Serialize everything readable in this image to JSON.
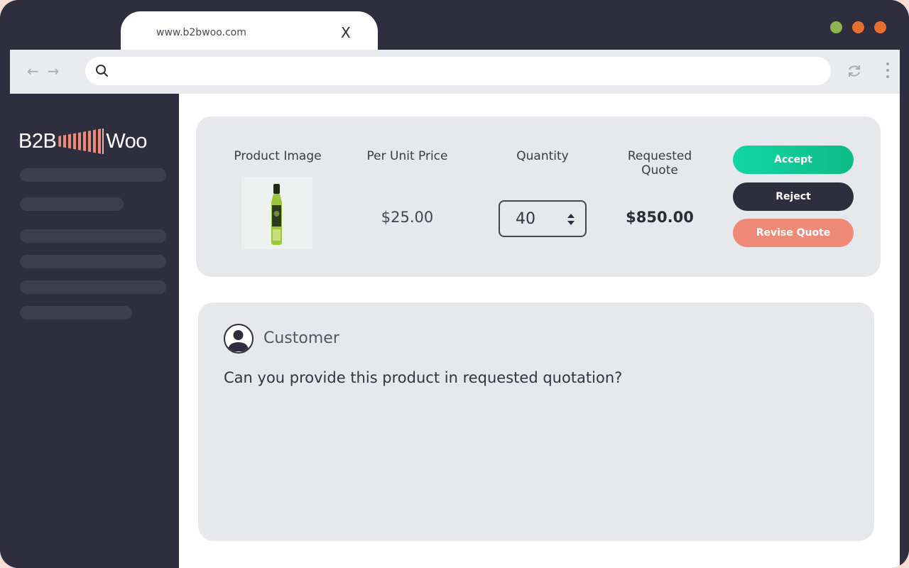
{
  "browser": {
    "tab_title": "www.b2bwoo.com",
    "tab_close": "X",
    "back": "←",
    "forward": "→",
    "url_value": "",
    "dot_colors": [
      "#8fb44f",
      "#e8702f",
      "#e8702f"
    ]
  },
  "sidebar": {
    "logo_left": "B2B",
    "logo_right": "Woo",
    "placeholder_count": 6
  },
  "quote": {
    "headers": {
      "product_image": "Product Image",
      "per_unit_price": "Per Unit Price",
      "quantity": "Quantity",
      "requested_quote": "Requested Quote"
    },
    "product_icon": "olive-oil-bottle",
    "per_unit_price": "$25.00",
    "quantity": "40",
    "requested_quote": "$850.00",
    "actions": {
      "accept": "Accept",
      "reject": "Reject",
      "revise": "Revise Quote"
    }
  },
  "message": {
    "sender": "Customer",
    "text": "Can you provide this product in requested quotation?"
  },
  "colors": {
    "accent_green": "#10c894",
    "dark": "#2f2e3f",
    "coral": "#ef8a78"
  }
}
